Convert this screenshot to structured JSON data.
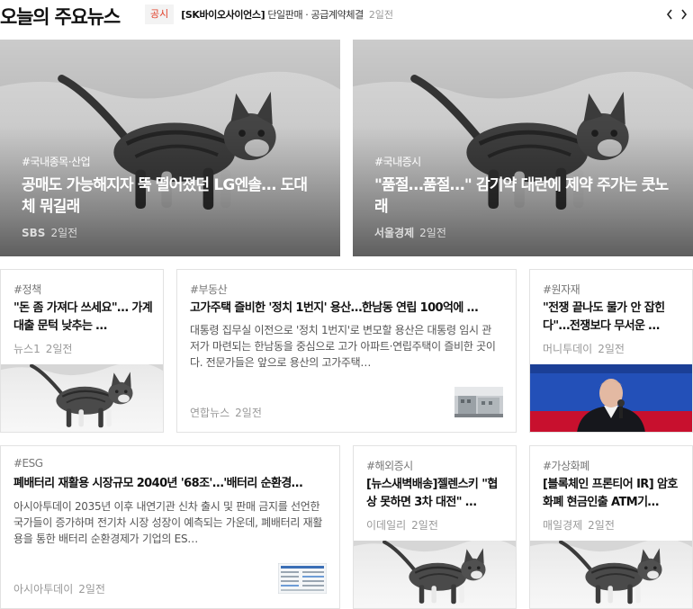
{
  "header": {
    "title": "오늘의 주요뉴스",
    "ticker_badge": "공시",
    "ticker_company": "[SK바이오사이언스]",
    "ticker_text": "단일판매 · 공급계약체결",
    "ticker_time": "2일전",
    "prev_icon": "chevron-left-icon",
    "next_icon": "chevron-right-icon"
  },
  "hero": [
    {
      "tag": "#국내종목·산업",
      "title": "공매도 가능해지자 뚝 떨어졌던 LG엔솔… 도대체 뭐길래",
      "source": "SBS",
      "time": "2일전"
    },
    {
      "tag": "#국내증시",
      "title": "\"품절…품절…\" 감기약 대란에 제약 주가는 쿳노래",
      "source": "서울경제",
      "time": "2일전"
    }
  ],
  "row1": [
    {
      "tag": "#정책",
      "title": "\"돈 좀 가져다 쓰세요\"… 가계대출 문턱 낮추는 …",
      "source": "뉴스1",
      "time": "2일전"
    },
    {
      "tag": "#부동산",
      "title": "고가주택 즐비한 '정치 1번지' 용산…한남동 연립 100억에 …",
      "desc": "대통령 집무실 이전으로 '정치 1번지'로 변모할 용산은 대통령 임시 관저가 마련되는 한남동을 중심으로 고가 아파트·연립주택이 즐비한 곳이다. 전문가들은 앞으로 용산의 고가주택…",
      "source": "연합뉴스",
      "time": "2일전"
    },
    {
      "tag": "#원자재",
      "title": "\"전쟁 끝나도 물가 안 잡힌다\"…전쟁보다 무서운 …",
      "source": "머니투데이",
      "time": "2일전"
    }
  ],
  "row2": [
    {
      "tag": "#ESG",
      "title": "폐배터리 재활용 시장규모 2040년 '68조'…'배터리 순환경…",
      "desc": "아시아투데이 2035년 이후 내연기관 신차 출시 및 판매 금지를 선언한 국가들이 증가하며 전기차 시장 성장이 예측되는 가운데, 폐배터리 재활용을 통한 배터리 순환경제가 기업의 ES…",
      "source": "아시아투데이",
      "time": "2일전"
    },
    {
      "tag": "#해외증시",
      "title": "[뉴스새벽배송]젤렌스키 \"협상 못하면 3차 대전\" …",
      "source": "이데일리",
      "time": "2일전"
    },
    {
      "tag": "#가상화폐",
      "title": "[블록체인 프론티어 IR] 암호화폐 현금인출 ATM기…",
      "source": "매일경제",
      "time": "2일전"
    }
  ]
}
